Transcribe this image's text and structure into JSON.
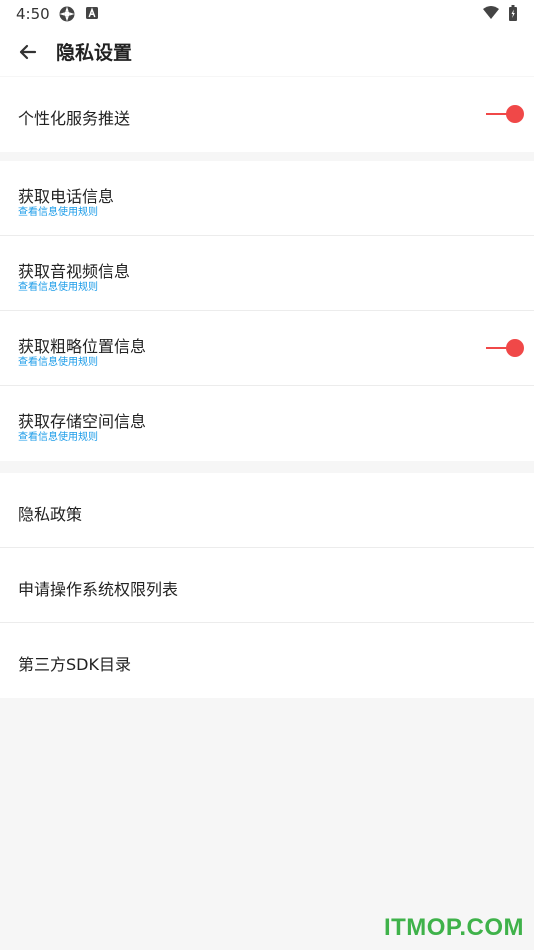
{
  "status": {
    "time": "4:50",
    "icons": [
      "settings-cog-icon",
      "a-badge-icon",
      "wifi-icon",
      "battery-icon"
    ]
  },
  "header": {
    "title": "隐私设置"
  },
  "sections": {
    "personalization": {
      "item": {
        "label": "个性化服务推送",
        "toggle_on": true
      }
    },
    "permissions": {
      "items": [
        {
          "label": "获取电话信息",
          "link": "查看信息使用规则"
        },
        {
          "label": "获取音视频信息",
          "link": "查看信息使用规则"
        },
        {
          "label": "获取粗略位置信息",
          "link": "查看信息使用规则",
          "toggle_on": true
        },
        {
          "label": "获取存储空间信息",
          "link": "查看信息使用规则"
        }
      ]
    },
    "policies": {
      "items": [
        {
          "label": "隐私政策"
        },
        {
          "label": "申请操作系统权限列表"
        },
        {
          "label": "第三方SDK目录"
        }
      ]
    }
  },
  "colors": {
    "accent": "#f04848",
    "link": "#1a9be8",
    "watermark": "#3fb24a"
  },
  "watermark": "ITMOP.COM"
}
